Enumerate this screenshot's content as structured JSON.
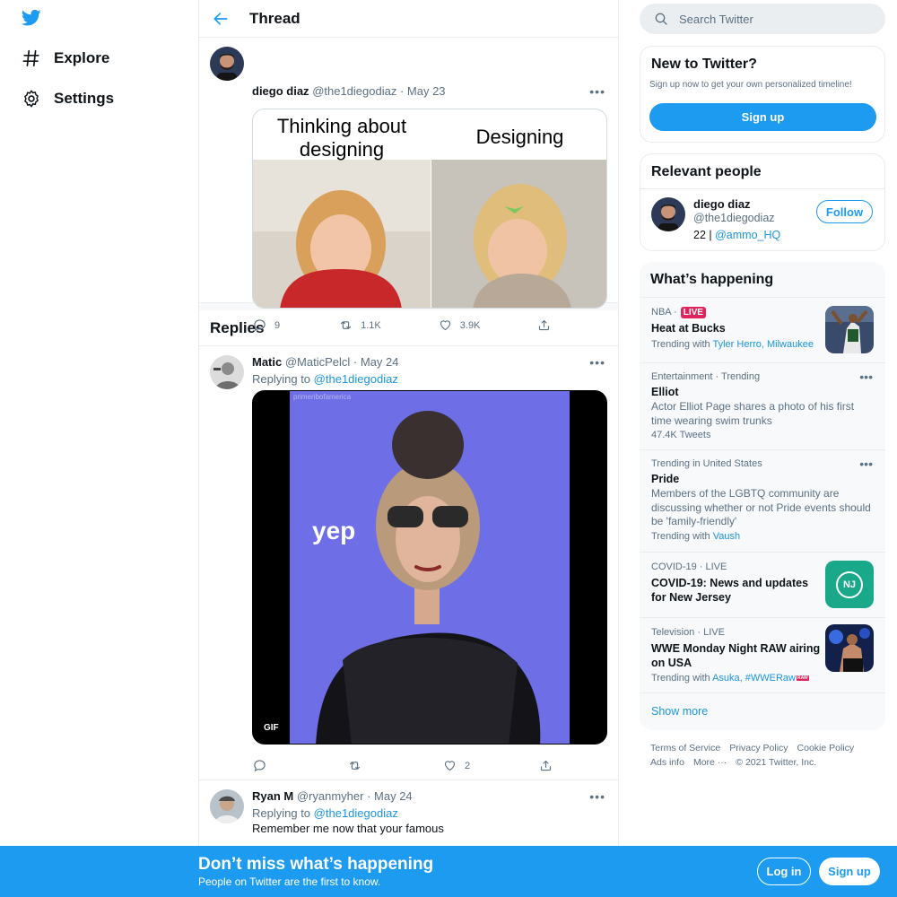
{
  "nav": {
    "items": [
      {
        "label": "Explore",
        "icon": "hashtag-icon"
      },
      {
        "label": "Settings",
        "icon": "gear-icon"
      }
    ]
  },
  "thread": {
    "title": "Thread",
    "main_tweet": {
      "name": "diego diaz",
      "handle": "@the1diegodiaz",
      "date": "· May 23",
      "more": "•••",
      "meme_left": "Thinking about designing",
      "meme_right": "Designing",
      "replies": "9",
      "retweets": "1.1K",
      "likes": "3.9K"
    },
    "replies_heading": "Replies",
    "reply1": {
      "name": "Matic",
      "handle": "@MaticPelcl",
      "date": "· May 24",
      "more": "•••",
      "replying_prefix": "Replying to",
      "replying_to": "@the1diegodiaz",
      "gif_caption": "yep",
      "gif_watermark": "primeribofamerica",
      "gif_badge": "GIF",
      "replies": "",
      "retweets": "",
      "likes": "2"
    },
    "reply2": {
      "name": "Ryan M",
      "handle": "@ryanmyher",
      "date": "· May 24",
      "more": "•••",
      "replying_prefix": "Replying to",
      "replying_to": "@the1diegodiaz",
      "text": "Remember me now that your famous"
    }
  },
  "search": {
    "placeholder": "Search Twitter"
  },
  "new_to_twitter": {
    "title": "New to Twitter?",
    "subtitle": "Sign up now to get your own personalized timeline!",
    "button": "Sign up"
  },
  "relevant": {
    "title": "Relevant people",
    "name": "diego diaz",
    "handle": "@the1diegodiaz",
    "bio_prefix": "22 |",
    "bio_link": "@ammo_HQ",
    "follow": "Follow"
  },
  "happening": {
    "title": "What’s happening",
    "trends": [
      {
        "context": "NBA ·",
        "live": "LIVE",
        "name": "Heat at Bucks",
        "trending_prefix": "Trending with",
        "trending_links": "Tyler Herro, Milwaukee"
      },
      {
        "context": "Entertainment · Trending",
        "name": "Elliot",
        "desc": "Actor Elliot Page shares a photo of his first time wearing swim trunks",
        "count": "47.4K Tweets",
        "more": "•••"
      },
      {
        "context": "Trending in United States",
        "name": "Pride",
        "desc": "Members of the LGBTQ community are discussing whether or not Pride events should be 'family-friendly'",
        "trending_prefix": "Trending with",
        "trending_links": "Vaush",
        "more": "•••"
      },
      {
        "context": "COVID-19 · LIVE",
        "name": "COVID-19: News and updates for New Jersey",
        "thumb_text": "NJ"
      },
      {
        "context": "Television · LIVE",
        "name": "WWE Monday Night RAW airing on USA",
        "trending_prefix": "Trending with",
        "trending_links": "Asuka, #WWERaw",
        "hashflag": "RAW"
      }
    ],
    "show_more": "Show more"
  },
  "footer": {
    "links": [
      "Terms of Service",
      "Privacy Policy",
      "Cookie Policy",
      "Ads info",
      "More ···"
    ],
    "copyright": "© 2021 Twitter, Inc."
  },
  "banner": {
    "title": "Don’t miss what’s happening",
    "subtitle": "People on Twitter are the first to know.",
    "login": "Log in",
    "signup": "Sign up"
  },
  "colors": {
    "accent": "#1d9bf0",
    "live": "#e0245e",
    "muted": "#5b7083"
  }
}
